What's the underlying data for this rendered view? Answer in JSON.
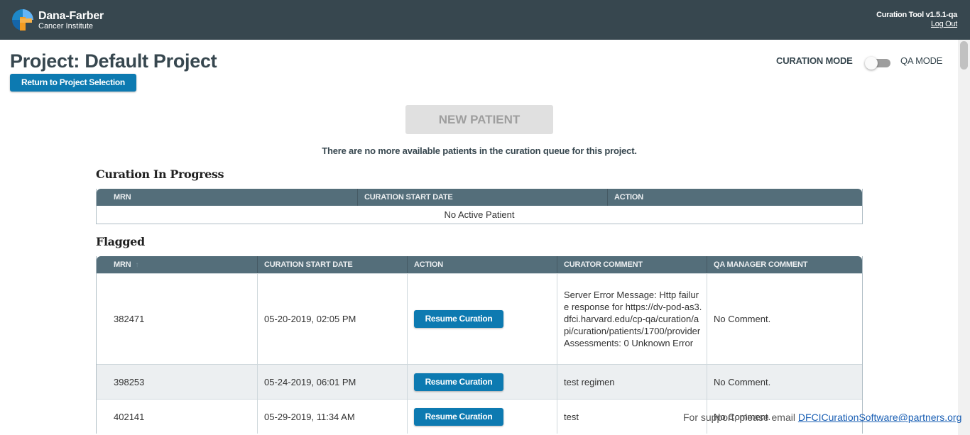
{
  "header": {
    "logo_name": "Dana-Farber",
    "logo_sub": "Cancer Institute",
    "app_version": "Curation Tool v1.5.1-qa",
    "logout_label": "Log Out",
    "colors": {
      "bar": "#37474f",
      "logo_blue": "#1e88c8",
      "logo_orange": "#f39c22"
    }
  },
  "page": {
    "title": "Project: Default Project",
    "return_label": "Return to Project Selection",
    "mode_label": "CURATION MODE",
    "qa_mode_label": "QA MODE",
    "qa_mode_enabled": false,
    "new_patient_label": "NEW PATIENT",
    "new_patient_disabled": true,
    "queue_message": "There are no more available patients in the curation queue for this project."
  },
  "in_progress": {
    "title": "Curation In Progress",
    "columns": [
      "MRN",
      "CURATION START DATE",
      "ACTION"
    ],
    "empty_message": "No Active Patient"
  },
  "flagged": {
    "title": "Flagged",
    "columns": [
      "MRN",
      "CURATION START DATE",
      "ACTION",
      "CURATOR COMMENT",
      "QA MANAGER COMMENT"
    ],
    "sort_icon": "arrow-up-icon",
    "rows": [
      {
        "mrn": "382471",
        "start_date": "05-20-2019, 02:05 PM",
        "action": "Resume Curation",
        "curator_comment": "Server Error Message: Http failure response for https://dv-pod-as3.dfci.harvard.edu/cp-qa/curation/api/curation/patients/1700/providerAssessments: 0 Unknown Error",
        "qa_comment": "No Comment."
      },
      {
        "mrn": "398253",
        "start_date": "05-24-2019, 06:01 PM",
        "action": "Resume Curation",
        "curator_comment": "test regimen",
        "qa_comment": "No Comment."
      },
      {
        "mrn": "402141",
        "start_date": "05-29-2019, 11:34 AM",
        "action": "Resume Curation",
        "curator_comment": "test",
        "qa_comment": "No Comment."
      }
    ]
  },
  "footer": {
    "support_text": "For support, please email",
    "support_email": "DFCICurationSoftware@partners.org"
  }
}
